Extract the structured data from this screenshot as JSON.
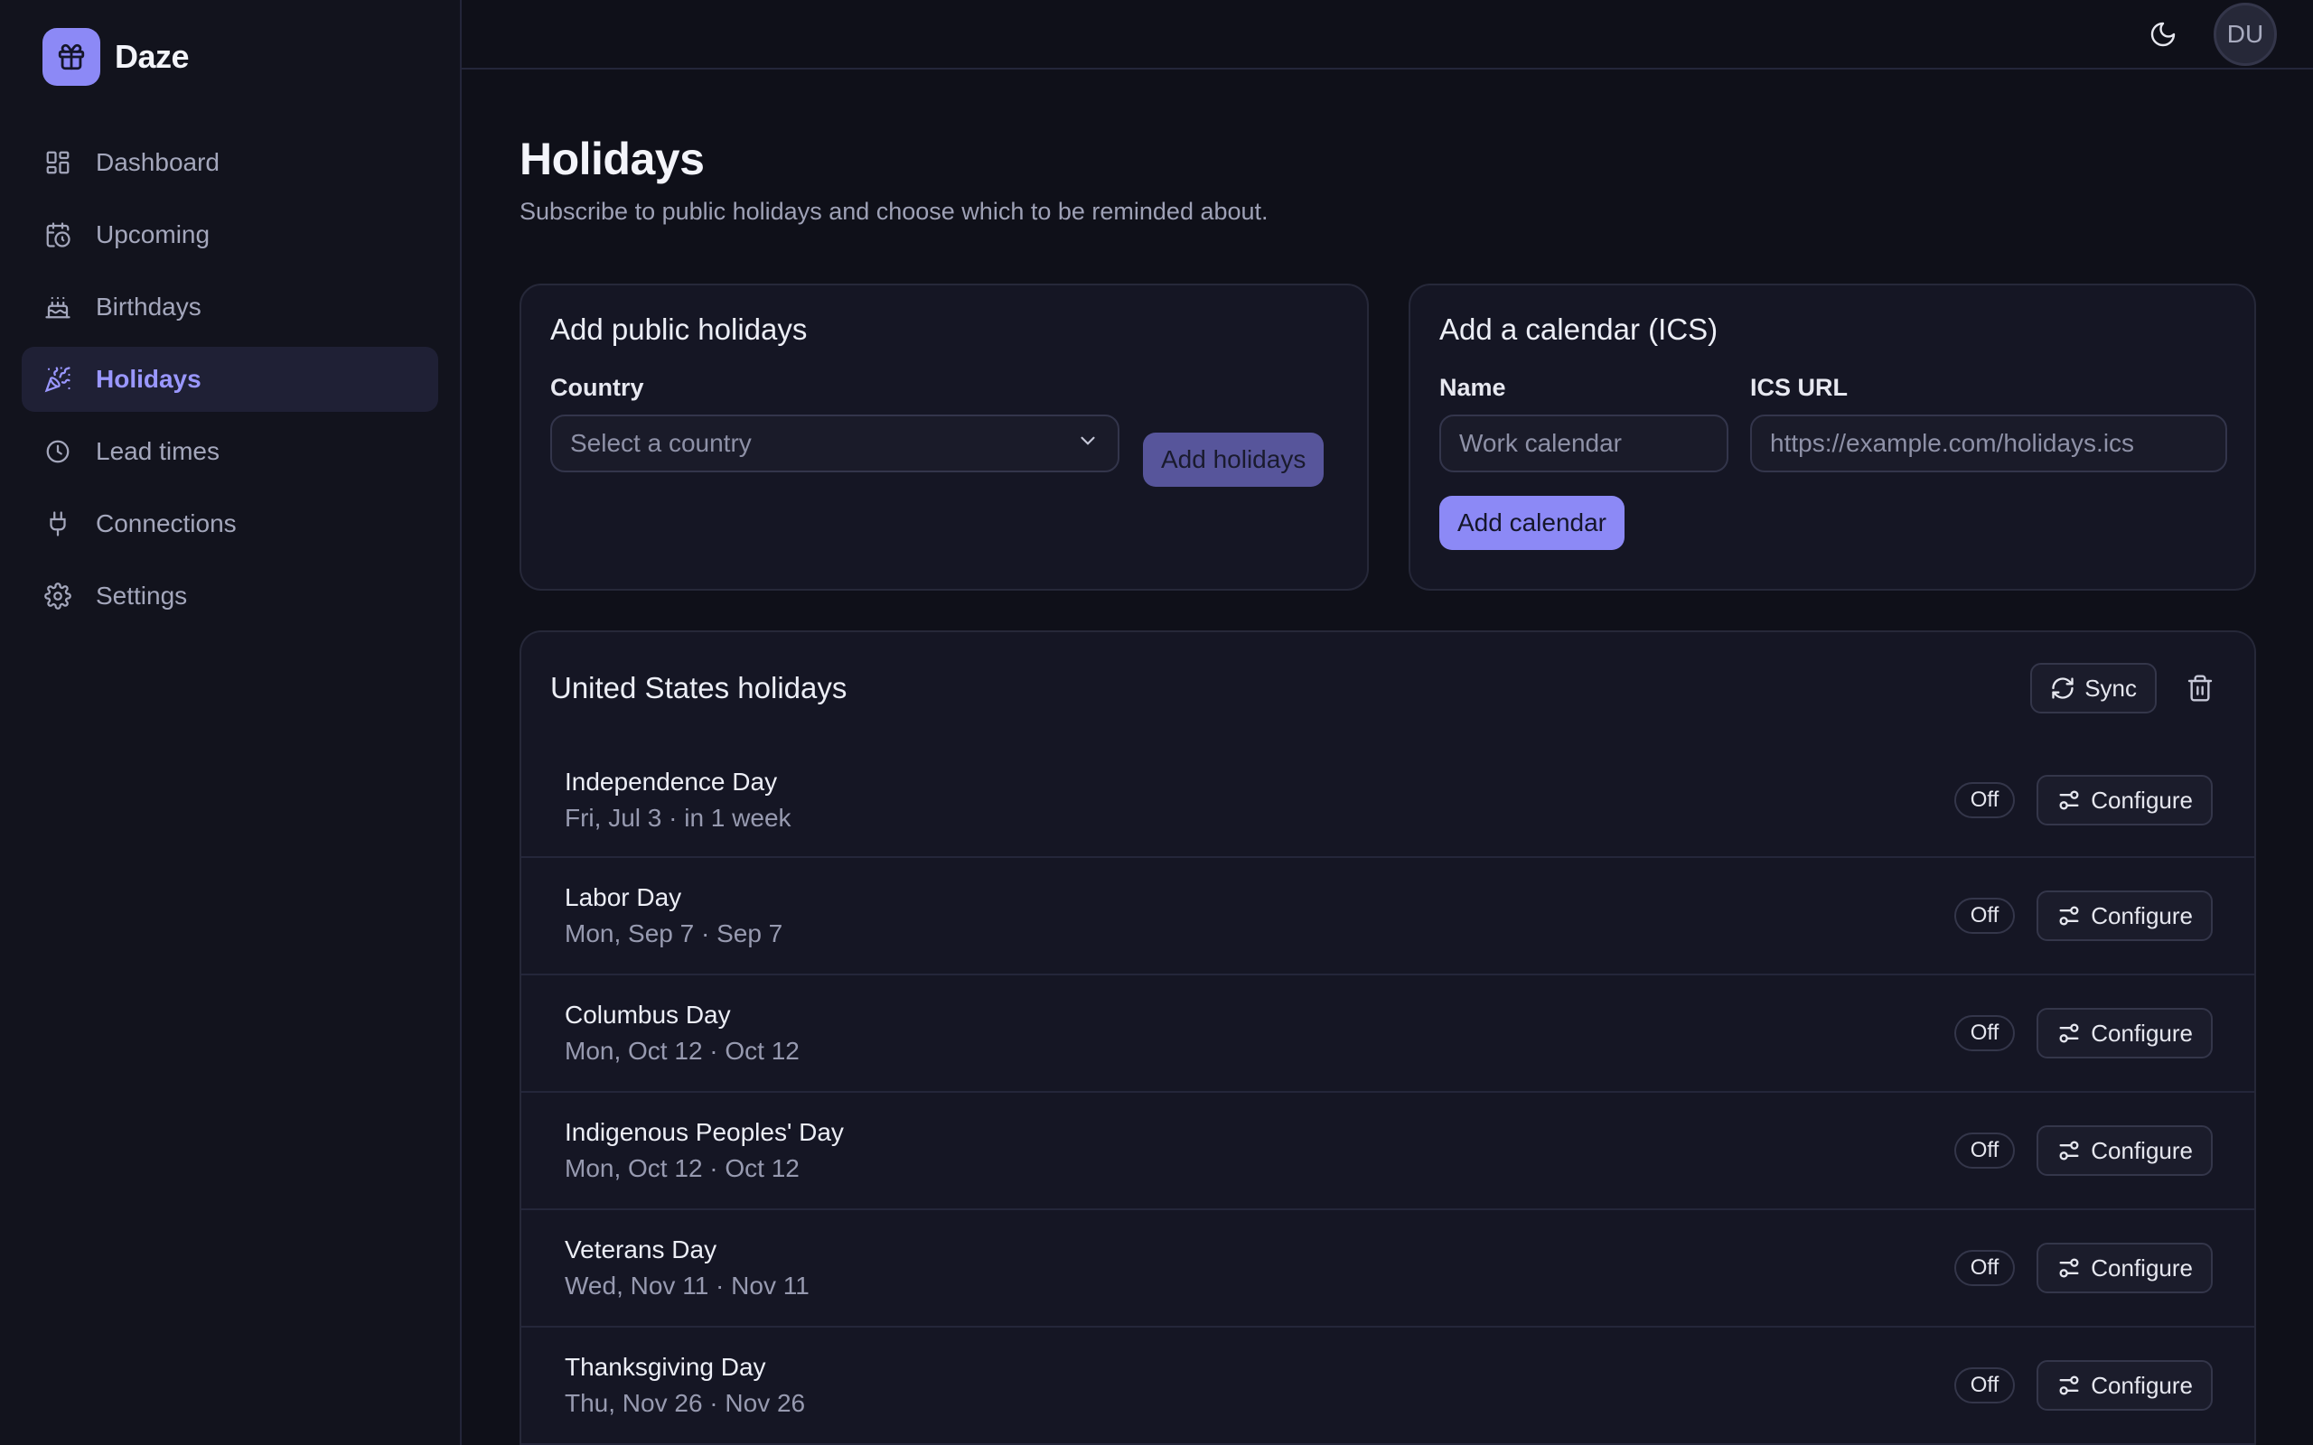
{
  "app": {
    "name": "Daze",
    "logo_icon": "gift-icon"
  },
  "sidebar": {
    "items": [
      {
        "label": "Dashboard",
        "icon": "dashboard-icon",
        "active": false
      },
      {
        "label": "Upcoming",
        "icon": "calendar-clock-icon",
        "active": false
      },
      {
        "label": "Birthdays",
        "icon": "cake-icon",
        "active": false
      },
      {
        "label": "Holidays",
        "icon": "party-popper-icon",
        "active": true
      },
      {
        "label": "Lead times",
        "icon": "clock-icon",
        "active": false
      },
      {
        "label": "Connections",
        "icon": "plug-icon",
        "active": false
      },
      {
        "label": "Settings",
        "icon": "gear-icon",
        "active": false
      }
    ]
  },
  "topbar": {
    "avatar_initials": "DU"
  },
  "page": {
    "title": "Holidays",
    "subtitle": "Subscribe to public holidays and choose which to be reminded about."
  },
  "public_card": {
    "title": "Add public holidays",
    "country_label": "Country",
    "country_placeholder": "Select a country",
    "add_button": "Add holidays"
  },
  "ics_card": {
    "title": "Add a calendar (ICS)",
    "name_label": "Name",
    "name_placeholder": "Work calendar",
    "url_label": "ICS URL",
    "url_placeholder": "https://example.com/holidays.ics",
    "add_button": "Add calendar"
  },
  "holiday_panel": {
    "title": "United States holidays",
    "sync_label": "Sync",
    "holidays": [
      {
        "name": "Independence Day",
        "date": "Fri, Jul 3 · in 1 week",
        "status": "Off",
        "configure": "Configure"
      },
      {
        "name": "Labor Day",
        "date": "Mon, Sep 7 · Sep 7",
        "status": "Off",
        "configure": "Configure"
      },
      {
        "name": "Columbus Day",
        "date": "Mon, Oct 12 · Oct 12",
        "status": "Off",
        "configure": "Configure"
      },
      {
        "name": "Indigenous Peoples' Day",
        "date": "Mon, Oct 12 · Oct 12",
        "status": "Off",
        "configure": "Configure"
      },
      {
        "name": "Veterans Day",
        "date": "Wed, Nov 11 · Nov 11",
        "status": "Off",
        "configure": "Configure"
      },
      {
        "name": "Thanksgiving Day",
        "date": "Thu, Nov 26 · Nov 26",
        "status": "Off",
        "configure": "Configure"
      }
    ]
  },
  "colors": {
    "accent": "#8c89f6",
    "background": "#0f1019",
    "sidebar": "#12131d",
    "card": "#151624"
  }
}
